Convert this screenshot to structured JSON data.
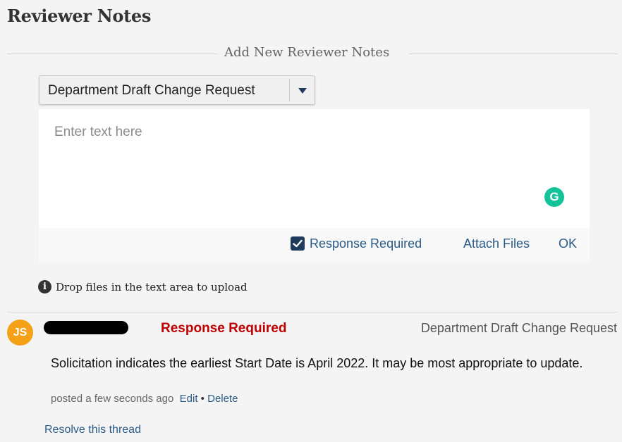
{
  "page": {
    "title": "Reviewer Notes"
  },
  "add_note": {
    "header": "Add New Reviewer Notes",
    "note_type_selected": "Department Draft Change Request",
    "placeholder": "Enter text here",
    "response_required_label": "Response Required",
    "response_required_checked": true,
    "attach_files_label": "Attach Files",
    "ok_label": "OK",
    "drop_hint": "Drop files in the text area to upload",
    "grammarly_letter": "G"
  },
  "thread": {
    "avatar_initials": "JS",
    "status_label": "Response Required",
    "note_type": "Department Draft Change Request",
    "body": "Solicitation indicates the earliest Start Date is April 2022. It may be most appropriate to update.",
    "posted": "posted a few seconds ago",
    "edit_label": "Edit",
    "separator": "•",
    "delete_label": "Delete",
    "resolve_label": "Resolve this thread"
  },
  "colors": {
    "accent_link": "#2a5a88",
    "required_red": "#c00000",
    "avatar": "#f4a118",
    "grammarly": "#15c39a",
    "checkbox": "#1f3b5c"
  },
  "icons": {
    "select_caret": "caret-down-icon",
    "checkbox": "checkmark-icon",
    "info": "info-icon",
    "grammarly": "grammarly-icon"
  }
}
